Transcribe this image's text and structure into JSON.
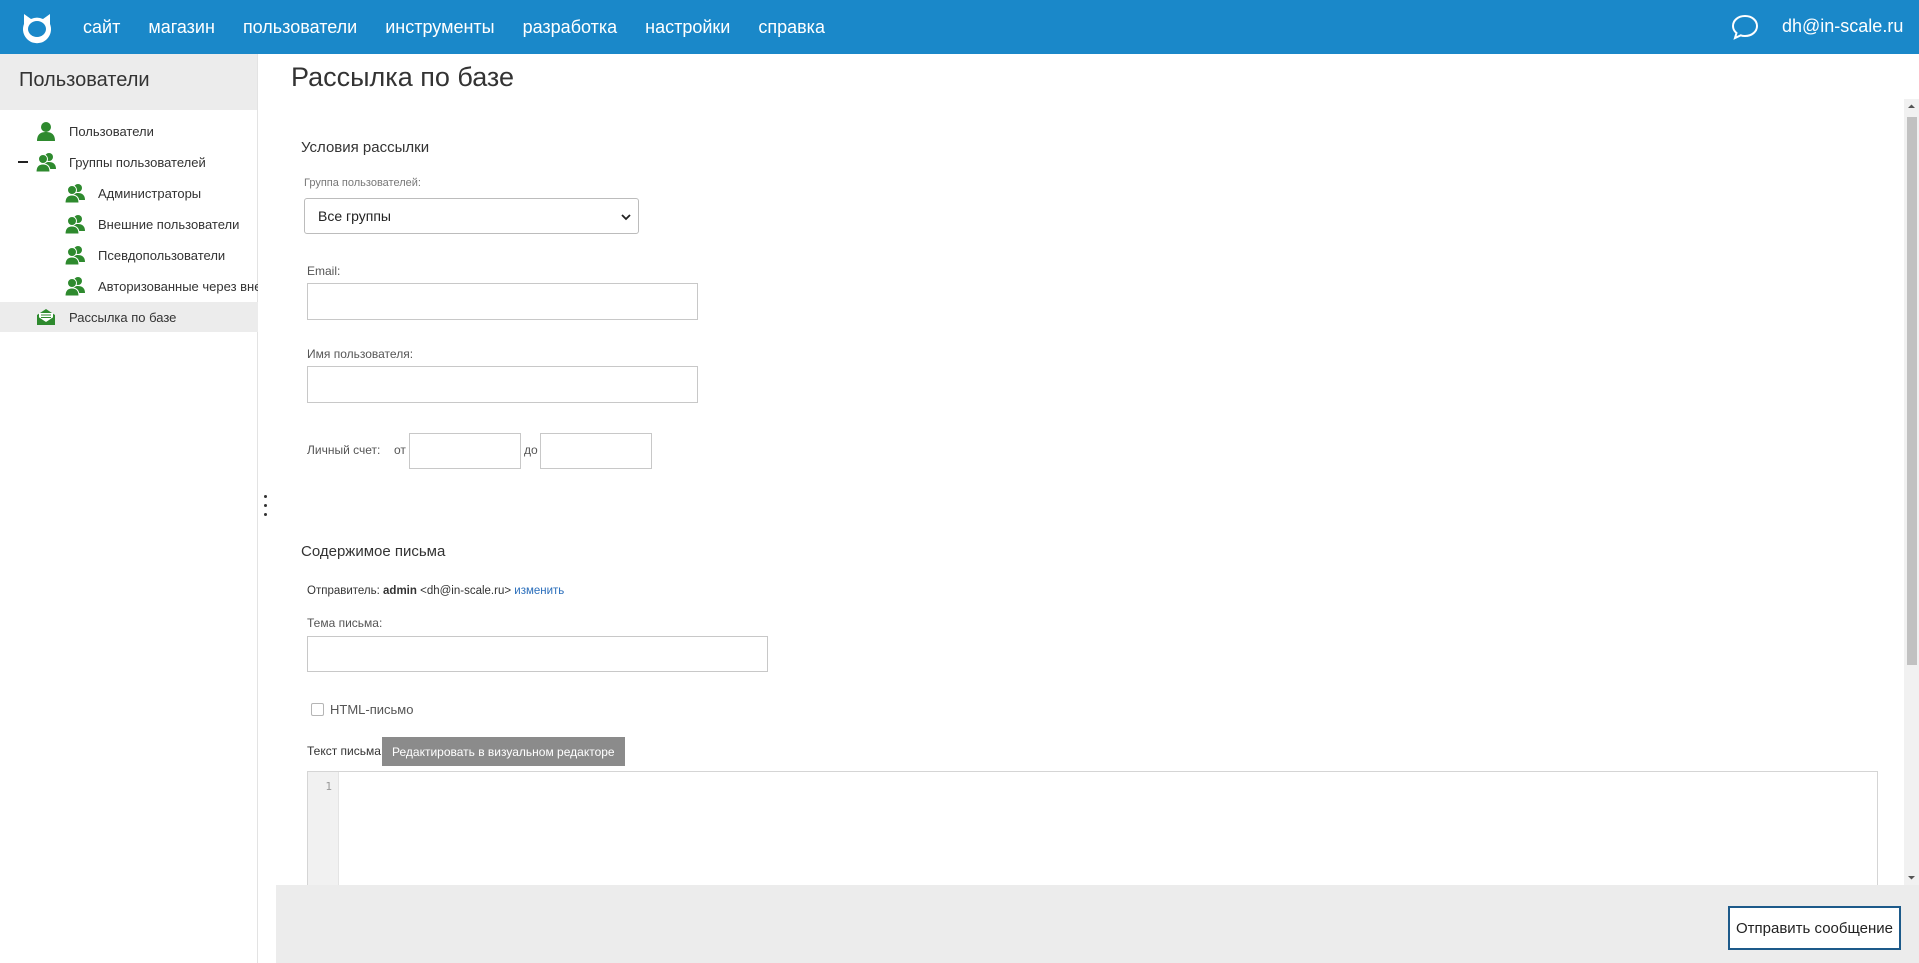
{
  "brand": {
    "accent_color": "#1a88c9",
    "logo_icon": "cat-logo-icon"
  },
  "nav": {
    "items": [
      "сайт",
      "магазин",
      "пользователи",
      "инструменты",
      "разработка",
      "настройки",
      "справка"
    ],
    "chat_icon": "chat-icon",
    "user_email": "dh@in-scale.ru"
  },
  "sidebar": {
    "title": "Пользователи",
    "items": [
      {
        "label": "Пользователи",
        "icon": "user-icon"
      },
      {
        "label": "Группы пользователей",
        "icon": "users-group-icon",
        "expanded": true
      },
      {
        "label": "Администраторы",
        "icon": "users-group-icon"
      },
      {
        "label": "Внешние пользователи",
        "icon": "users-group-icon"
      },
      {
        "label": "Псевдопользователи",
        "icon": "users-group-icon"
      },
      {
        "label": "Авторизованные через внешние",
        "icon": "users-group-icon"
      },
      {
        "label": "Рассылка по базе",
        "icon": "mail-icon",
        "active": true
      }
    ]
  },
  "page": {
    "title": "Рассылка по базе",
    "conditions": {
      "title": "Условия рассылки",
      "group_label": "Группа пользователей:",
      "group_value": "Все группы",
      "email_label": "Email:",
      "email_value": "",
      "username_label": "Имя пользователя:",
      "username_value": "",
      "account_label": "Личный счет:",
      "from_label": "от",
      "to_label": "до",
      "from_value": "",
      "to_value": ""
    },
    "content": {
      "title": "Содержимое письма",
      "sender_label": "Отправитель:",
      "sender_name": "admin",
      "sender_email": "<dh@in-scale.ru>",
      "change_link": "изменить",
      "subject_label": "Тема письма:",
      "subject_value": "",
      "html_checkbox_label": "HTML-письмо",
      "html_checked": false,
      "body_label": "Текст письма:",
      "visual_editor_button": "Редактировать в визуальном редакторе",
      "editor_line_number": "1"
    }
  },
  "footer": {
    "send_button": "Отправить сообщение"
  }
}
